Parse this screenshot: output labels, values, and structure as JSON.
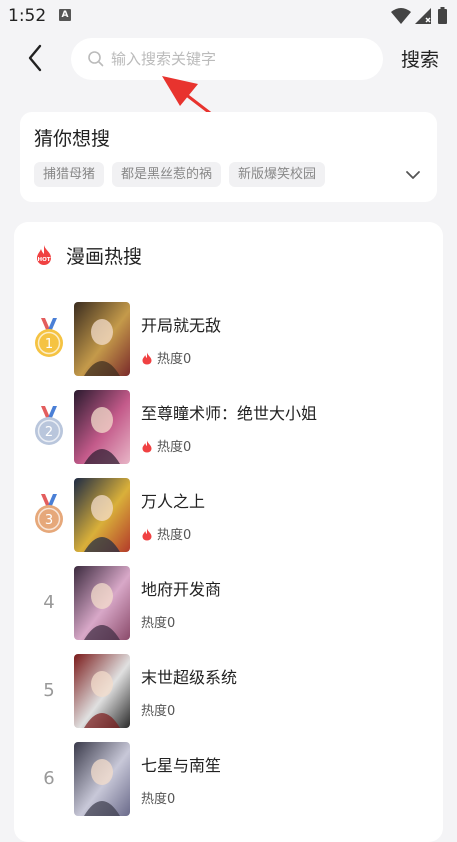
{
  "status_bar": {
    "time": "1:52",
    "indicator": "A"
  },
  "search": {
    "placeholder": "输入搜索关键字",
    "value": "",
    "button_label": "搜索"
  },
  "guess": {
    "title": "猜你想搜",
    "tags": [
      "捕猎母猪",
      "都是黑丝惹的祸",
      "新版爆笑校园"
    ]
  },
  "hot": {
    "title": "漫画热搜",
    "items": [
      {
        "rank": "1",
        "title": "开局就无敌",
        "heat": "热度0",
        "medal": "gold",
        "cover_colors": [
          "#3a2c1f",
          "#c49a4a",
          "#7a2a2a"
        ]
      },
      {
        "rank": "2",
        "title": "至尊瞳术师：绝世大小姐",
        "heat": "热度0",
        "medal": "silver",
        "cover_colors": [
          "#2a1a2e",
          "#c35a8a",
          "#e8b6c7"
        ]
      },
      {
        "rank": "3",
        "title": "万人之上",
        "heat": "热度0",
        "medal": "bronze",
        "cover_colors": [
          "#1d2a44",
          "#d9b03a",
          "#b33a2a"
        ]
      },
      {
        "rank": "4",
        "title": "地府开发商",
        "heat": "热度0",
        "medal": "",
        "cover_colors": [
          "#3b2a3e",
          "#d8a8c8",
          "#8a4a6a"
        ]
      },
      {
        "rank": "5",
        "title": "末世超级系统",
        "heat": "热度0",
        "medal": "",
        "cover_colors": [
          "#7a1a1a",
          "#e0e0e0",
          "#2a2a2a"
        ]
      },
      {
        "rank": "6",
        "title": "七星与南笙",
        "heat": "热度0",
        "medal": "",
        "cover_colors": [
          "#3a3a4a",
          "#c8c8d8",
          "#6a6a8a"
        ]
      }
    ]
  },
  "colors": {
    "accent_red": "#f04142",
    "medal_gold": "#f5c342",
    "medal_silver": "#b9c6dc",
    "medal_bronze": "#e6a87a"
  }
}
